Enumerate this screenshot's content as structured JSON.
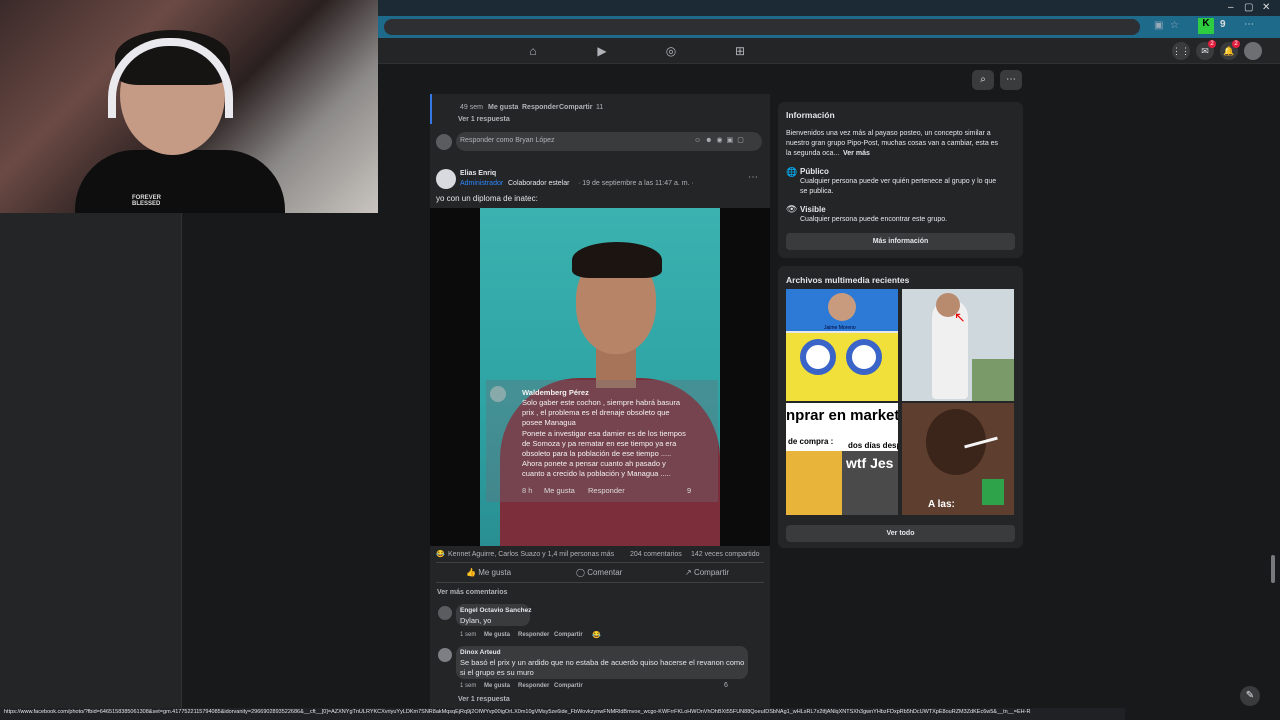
{
  "nav": {
    "icons": [
      "home-icon",
      "video-icon",
      "groups-icon",
      "gaming-icon"
    ]
  },
  "header_icons": [
    "apps-icon",
    "messenger-icon",
    "notifications-icon",
    "profile-avatar"
  ],
  "badges": {
    "messenger": "2",
    "notifications": "2"
  },
  "webcam": {
    "shirt_text_1": "FOREVER",
    "shirt_text_2": "BLESSED"
  },
  "prev_comment": {
    "time": "49 sem",
    "like": "Me gusta",
    "reply": "Responder",
    "share": "Compartir",
    "reactions": "11",
    "see_reply": "Ver 1 respuesta",
    "reply_placeholder": "Responder como Bryan López"
  },
  "post": {
    "author": "Elias Enriq",
    "role": "Administrador",
    "badge": "Colaborador estelar",
    "date": "· 19 de septiembre a las 11:47 a. m. ·",
    "text": "yo con un diploma de inatec:",
    "overlay": {
      "name": "Waldemberg Pérez",
      "lines": [
        "Solo gaber este cochon , siempre habrá basura",
        "prix , el problema es el drenaje  obsoleto que",
        "posee Managua",
        "Ponete a investigar esa damier es de los tiempos",
        "de Somoza y pa rematar en ese tiempo ya era",
        "obsoleto para la población de ese tiempo .....",
        "Ahora ponete a pensar cuanto ah pasado y",
        "cuanto a crecido la población y Managua ....."
      ],
      "time": "8 h",
      "like": "Me gusta",
      "reply": "Responder",
      "reactions": "9"
    },
    "reactions_text": "Kennet Aguirre, Carlos Suazo y 1,4 mil personas más",
    "comments_count": "204 comentarios",
    "shares_count": "142 veces compartido",
    "actions": {
      "like": "Me gusta",
      "comment": "Comentar",
      "share": "Compartir"
    },
    "more_comments": "Ver más comentarios",
    "comments": [
      {
        "author": "Engel Octavio Sanchez",
        "text": "Dylan, yo",
        "time": "1 sem",
        "like": "Me gusta",
        "reply": "Responder",
        "share": "Compartir"
      },
      {
        "author": "Dinox Arteud",
        "text_1": "Se basó el prix y un ardido que no estaba de acuerdo quiso hacerse el revanon como",
        "text_2": "si el grupo es su muro",
        "time": "1 sem",
        "like": "Me gusta",
        "reply": "Responder",
        "share": "Compartir",
        "reactions": "6",
        "see_reply": "Ver 1 respuesta"
      }
    ]
  },
  "info": {
    "title": "Información",
    "desc_1": "Bienvenidos una vez más al payaso posteo, un concepto similar a",
    "desc_2": "nuestro gran grupo Pipo-Post, muchas cosas van a cambiar, esta es",
    "desc_3": "la segunda oca...",
    "see_more": "Ver más",
    "public_title": "Público",
    "public_desc_1": "Cualquier persona puede ver quién pertenece al grupo y lo que",
    "public_desc_2": "se publica.",
    "visible_title": "Visible",
    "visible_desc": "Cualquier persona puede encontrar este grupo.",
    "more_info": "Más información"
  },
  "media": {
    "title": "Archivos multimedia recientes",
    "caption_1": "Jaime Moreno",
    "caption_2": "nprar en marketpla",
    "caption_3": "de compra :",
    "caption_4": "dos días despu",
    "caption_5": "wtf Jes",
    "caption_6": "A las:",
    "see_all": "Ver todo"
  },
  "statusbar_url": "https://www.facebook.com/photo/?fbid=6465158385061308&set=gm.4177522115794085&idorvanity=2966902893522686&__cft__[0]=AZXNYgTnULRYKCXvriyuYyLDKm7SNR8akMqsqEjRq9j2OIWYvp00igOrLX0m10gVMsy5ze6ide_FbWovkzynwFNMRldBmvoe_wcgo-KWFrrFKLoHWOnVhOhBXt55FUN88QoeuIDSbNAg1_wHLsRL7x2tfjANlqXNTSXh3gwnYHbzFDxpRb5hDcUWTXpE8ouRZM3ZdKEc6w5&__tn__=EH-R"
}
